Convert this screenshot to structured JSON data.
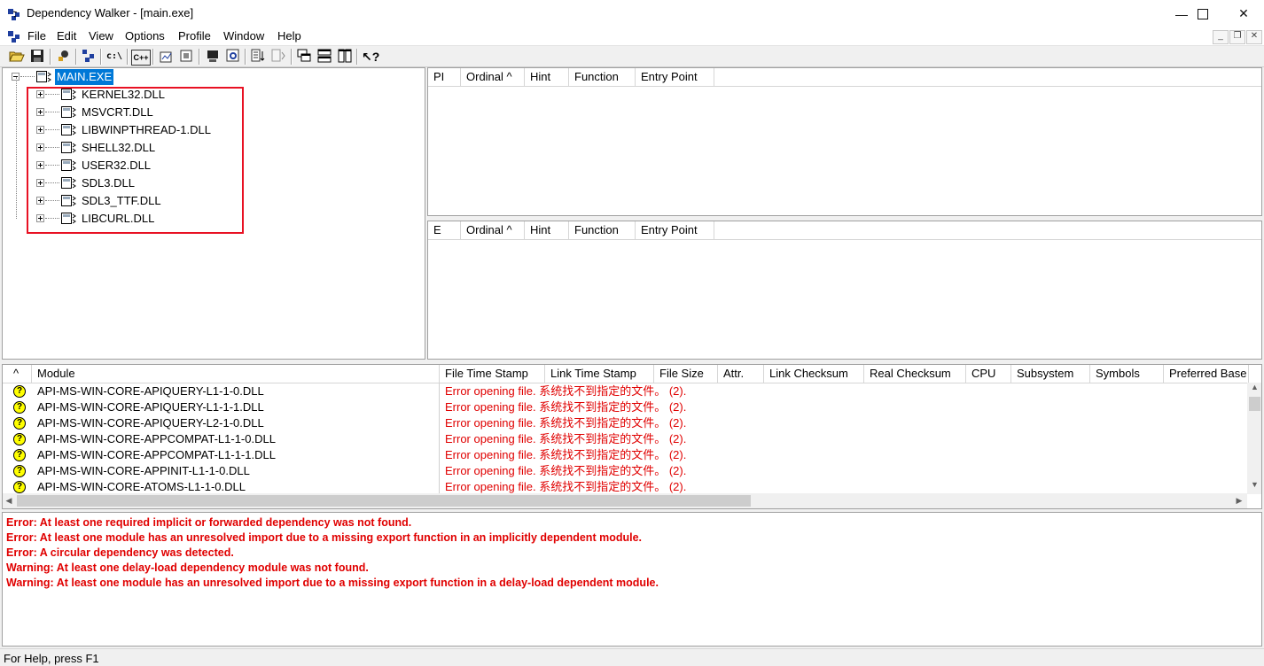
{
  "window": {
    "title": "Dependency Walker - [main.exe]",
    "minimize": "—",
    "maximize": "☐",
    "close": "✕"
  },
  "menu": [
    "File",
    "Edit",
    "View",
    "Options",
    "Profile",
    "Window",
    "Help"
  ],
  "mdi_buttons": [
    "_",
    "̄❐",
    "✕"
  ],
  "toolbar": {
    "cdir_label": "c:\\",
    "cpp_label": "C++"
  },
  "tree": {
    "root": "MAIN.EXE",
    "children": [
      "KERNEL32.DLL",
      "MSVCRT.DLL",
      "LIBWINPTHREAD-1.DLL",
      "SHELL32.DLL",
      "USER32.DLL",
      "SDL3.DLL",
      "SDL3_TTF.DLL",
      "LIBCURL.DLL"
    ]
  },
  "imports_pane": {
    "columns": [
      "PI",
      "Ordinal ^",
      "Hint",
      "Function",
      "Entry Point"
    ]
  },
  "exports_pane": {
    "columns": [
      "E",
      "Ordinal ^",
      "Hint",
      "Function",
      "Entry Point"
    ]
  },
  "module_list": {
    "columns": [
      "^",
      "Module",
      "File Time Stamp",
      "Link Time Stamp",
      "File Size",
      "Attr.",
      "Link Checksum",
      "Real Checksum",
      "CPU",
      "Subsystem",
      "Symbols",
      "Preferred Base"
    ],
    "rows": [
      {
        "icon": "?",
        "module": "API-MS-WIN-CORE-APIQUERY-L1-1-0.DLL",
        "status": "Error opening file. 系统找不到指定的文件。 (2)."
      },
      {
        "icon": "?",
        "module": "API-MS-WIN-CORE-APIQUERY-L1-1-1.DLL",
        "status": "Error opening file. 系统找不到指定的文件。 (2)."
      },
      {
        "icon": "?",
        "module": "API-MS-WIN-CORE-APIQUERY-L2-1-0.DLL",
        "status": "Error opening file. 系统找不到指定的文件。 (2)."
      },
      {
        "icon": "?",
        "module": "API-MS-WIN-CORE-APPCOMPAT-L1-1-0.DLL",
        "status": "Error opening file. 系统找不到指定的文件。 (2)."
      },
      {
        "icon": "?",
        "module": "API-MS-WIN-CORE-APPCOMPAT-L1-1-1.DLL",
        "status": "Error opening file. 系统找不到指定的文件。 (2)."
      },
      {
        "icon": "?",
        "module": "API-MS-WIN-CORE-APPINIT-L1-1-0.DLL",
        "status": "Error opening file. 系统找不到指定的文件。 (2)."
      },
      {
        "icon": "?",
        "module": "API-MS-WIN-CORE-ATOMS-L1-1-0.DLL",
        "status": "Error opening file. 系统找不到指定的文件。 (2)."
      }
    ]
  },
  "log": [
    "Error: At least one required implicit or forwarded dependency was not found.",
    "Error: At least one module has an unresolved import due to a missing export function in an implicitly dependent module.",
    "Error: A circular dependency was detected.",
    "Warning: At least one delay-load dependency module was not found.",
    "Warning: At least one module has an unresolved import due to a missing export function in a delay-load dependent module."
  ],
  "status_bar": "For Help, press F1",
  "colors": {
    "error": "#e00000",
    "highlight_box": "#e81123",
    "selection": "#0078d7"
  }
}
